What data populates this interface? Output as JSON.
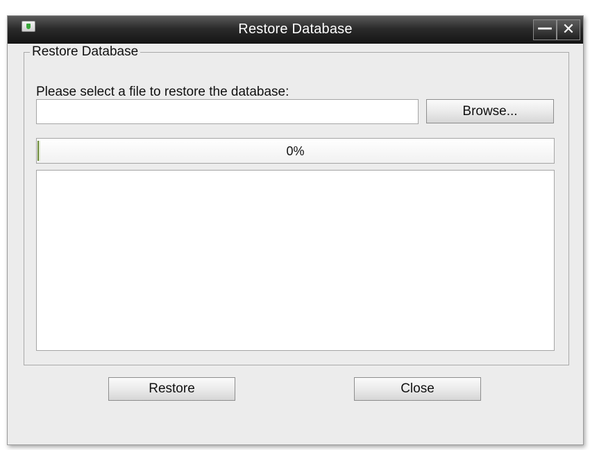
{
  "window": {
    "title": "Restore Database",
    "minimize_glyph": "—",
    "close_glyph": "✕"
  },
  "group": {
    "legend": "Restore Database",
    "prompt": "Please select a file to restore the database:"
  },
  "file_input": {
    "value": "",
    "placeholder": ""
  },
  "buttons": {
    "browse": "Browse...",
    "restore": "Restore",
    "close": "Close"
  },
  "progress": {
    "label": "0%",
    "value": 0
  },
  "log": {
    "value": ""
  },
  "icons": {
    "app": "shield-icon",
    "minimize": "minimize-icon",
    "close": "close-icon"
  },
  "colors": {
    "titlebar": "#1e1e1e",
    "window_bg": "#ececec",
    "progress_accent": "#6d8a3a"
  }
}
